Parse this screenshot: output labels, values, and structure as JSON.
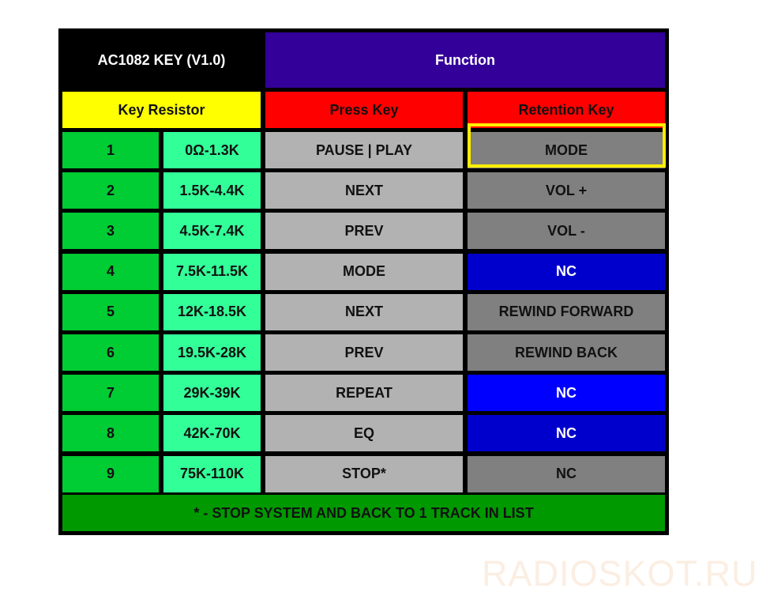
{
  "header": {
    "title": "AC1082 KEY (V1.0)",
    "function": "Function"
  },
  "subheader": {
    "key_resistor": "Key Resistor",
    "press_key": "Press Key",
    "retention_key": "Retention Key"
  },
  "colors": {
    "title_bg": "#000000",
    "function_bg": "#330099",
    "key_resistor_bg": "#ffff00",
    "press_key_bg": "#ff0000",
    "number_bg": "#00cc33",
    "range_bg": "#33ff99",
    "press_bg": "#b2b2b2",
    "footer_bg": "#009900",
    "highlight": "#ffee00"
  },
  "rows": [
    {
      "num": "1",
      "range": "0Ω-1.3K",
      "press": "PAUSE | PLAY",
      "retention": "MODE",
      "retention_bg": "#808080",
      "highlighted": true
    },
    {
      "num": "2",
      "range": "1.5K-4.4K",
      "press": "NEXT",
      "retention": "VOL +",
      "retention_bg": "#808080"
    },
    {
      "num": "3",
      "range": "4.5K-7.4K",
      "press": "PREV",
      "retention": "VOL -",
      "retention_bg": "#808080"
    },
    {
      "num": "4",
      "range": "7.5K-11.5K",
      "press": "MODE",
      "retention": "NC",
      "retention_bg": "#0000cc"
    },
    {
      "num": "5",
      "range": "12K-18.5K",
      "press": "NEXT",
      "retention": "REWIND FORWARD",
      "retention_bg": "#808080"
    },
    {
      "num": "6",
      "range": "19.5K-28K",
      "press": "PREV",
      "retention": "REWIND BACK",
      "retention_bg": "#808080"
    },
    {
      "num": "7",
      "range": "29K-39K",
      "press": "REPEAT",
      "retention": "NC",
      "retention_bg": "#0000ff"
    },
    {
      "num": "8",
      "range": "42K-70K",
      "press": "EQ",
      "retention": "NC",
      "retention_bg": "#0000cc"
    },
    {
      "num": "9",
      "range": "75K-110K",
      "press": "STOP*",
      "retention": "NC",
      "retention_bg": "#808080"
    }
  ],
  "footer": "* - STOP SYSTEM AND BACK TO 1 TRACK IN LIST",
  "watermark": "RADIOSKOT.RU"
}
